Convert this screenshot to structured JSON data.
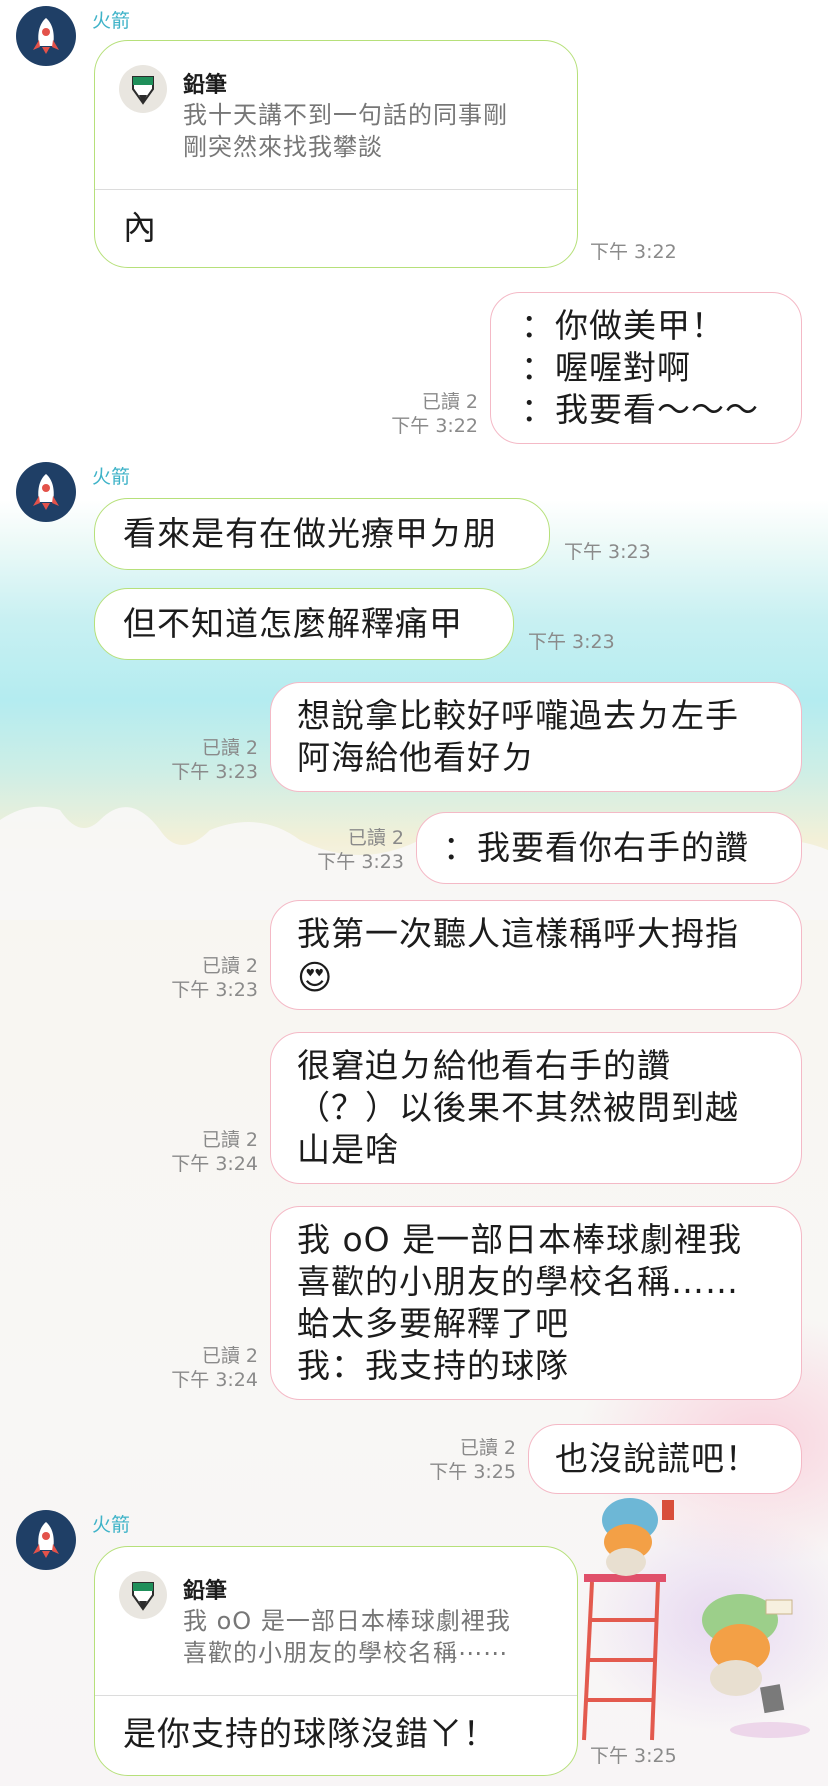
{
  "colors": {
    "incoming_border": "#b6e07a",
    "outgoing_border": "#f4b9c6",
    "sender_name": "#3fb3c8",
    "avatar_bg": "#1f3f66"
  },
  "messages": [
    {
      "type": "incoming_reply",
      "sender": "火箭",
      "reply_to_name": "鉛筆",
      "reply_to_text": "我十天講不到一句話的同事剛\n剛突然來找我攀談",
      "text": "內",
      "time": "下午 3:22"
    },
    {
      "type": "outgoing",
      "text": "：你做美甲！\n：喔喔對啊\n：我要看～～～",
      "read": "已讀 2",
      "time": "下午 3:22"
    },
    {
      "type": "incoming",
      "sender": "火箭",
      "text": "看來是有在做光療甲ㄉ朋",
      "time": "下午 3:23"
    },
    {
      "type": "incoming",
      "text": "但不知道怎麼解釋痛甲",
      "time": "下午 3:23"
    },
    {
      "type": "outgoing",
      "text": "想說拿比較好呼嚨過去ㄉ左手\n阿海給他看好ㄉ",
      "read": "已讀 2",
      "time": "下午 3:23"
    },
    {
      "type": "outgoing",
      "text": "：我要看你右手的讚",
      "read": "已讀 2",
      "time": "下午 3:23"
    },
    {
      "type": "outgoing",
      "text": "我第一次聽人這樣稱呼大拇指",
      "emoji": "😍",
      "read": "已讀 2",
      "time": "下午 3:23"
    },
    {
      "type": "outgoing",
      "text": "很窘迫ㄉ給他看右手的讚\n（？）以後果不其然被問到越\n山是啥",
      "read": "已讀 2",
      "time": "下午 3:24"
    },
    {
      "type": "outgoing",
      "text": "我 oO 是一部日本棒球劇裡我\n喜歡的小朋友的學校名稱……\n蛤太多要解釋了吧\n我：我支持的球隊",
      "read": "已讀 2",
      "time": "下午 3:24"
    },
    {
      "type": "outgoing",
      "text": "也沒說謊吧！",
      "read": "已讀 2",
      "time": "下午 3:25"
    },
    {
      "type": "incoming_reply",
      "sender": "火箭",
      "reply_to_name": "鉛筆",
      "reply_to_text": "我 oO 是一部日本棒球劇裡我\n喜歡的小朋友的學校名稱⋯⋯",
      "text": "是你支持的球隊沒錯ㄚ！",
      "time": "下午 3:25"
    }
  ]
}
